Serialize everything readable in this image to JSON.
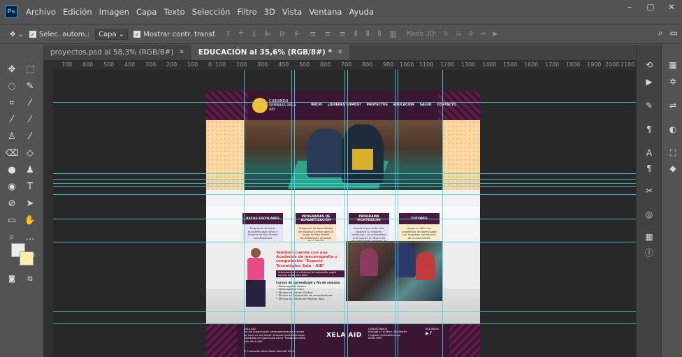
{
  "app": {
    "logo": "Ps"
  },
  "menu": [
    "Archivo",
    "Edición",
    "Imagen",
    "Capa",
    "Texto",
    "Selección",
    "Filtro",
    "3D",
    "Vista",
    "Ventana",
    "Ayuda"
  ],
  "window_controls": {
    "minimize": "–",
    "maximize": "▢",
    "close": "✕"
  },
  "options": {
    "auto_select_label": "Selec. autom.:",
    "auto_select_value": "Capa",
    "show_transform_label": "Mostrar contr. transf.",
    "mode3d_label": "Modo 3D:"
  },
  "tabs": [
    {
      "label": "proyectos.psd al 58,3% (RGB/8#)",
      "close": "✕"
    },
    {
      "label": "EDUCACIÓN al 35,6% (RGB/8#) *",
      "close": "✕"
    }
  ],
  "ruler_ticks": [
    "700",
    "600",
    "500",
    "400",
    "300",
    "200",
    "100",
    "0",
    "100",
    "200",
    "300",
    "400",
    "500",
    "600",
    "700",
    "800",
    "900",
    "1000",
    "1100",
    "1200",
    "1300",
    "1400",
    "1500",
    "1600",
    "1700",
    "1800",
    "1900",
    "2000",
    "2100"
  ],
  "document": {
    "logo_text": "CUIDANDO SEMBRAS XELA AID",
    "nav": [
      "INICIO",
      "¿QUIÉNES SOMOS?",
      "PROYECTOS",
      "EDUCACIÓN",
      "SALUD",
      "CONTACTO"
    ],
    "cards": [
      {
        "title": "BECAS ESCOLARES",
        "body": "Programa de becas escolares para niños y jóvenes de San Martín Sacatepéquez"
      },
      {
        "title": "PROGRAMAS DE ALFABETIZACIÓN",
        "body": "Programa de aprendizaje de español a mam para la mujer de San Martín Sacatepéquez ayudada por CONALFA"
      },
      {
        "title": "PROGRAMA MONTESSORI",
        "body": "Ayuda a que cada niño alcance su máximo potencial. Las actividades promueven el desarrollo de habilidades sociales, el crecimiento emocional y la coordinación física."
      },
      {
        "title": "TUTORES",
        "body": "Apoyo a niños con problemas de aprendizaje por maestros voluntarios de la comunidad."
      }
    ],
    "academy_title": "También cuenta con una Academia de mecanografía y computación \"Espacio Tecnológico Sala - AID\"",
    "academy_bar": "Autorizado por el ministerio de educación, según número de No. 045-2020",
    "academy_list_title": "Cursos de aprendizaje y fin de semana",
    "academy_list": [
      "Mecanografía Básica",
      "Mecanografía Libre",
      "Técnico en Diseño Gráfico",
      "Técnico en Reparación de computadoras",
      "Técnico en Diseño de Páginas Web"
    ],
    "footer": {
      "about_title": "XELA AID",
      "about_text": "Es una organización centroamericana sin ánimo de lucro en San Martín Chiquito Quetzaltenango, registrada en Guatemala como \"Fundación Maria Sala XELA AID\"",
      "brand": "XELA AID",
      "contact_title": "CONTÁCTANOS",
      "contact_address": "Entrada a Txj Mam, San Martín Chiquito, Quetzaltenango",
      "contact_phone": "0008-7999",
      "social_title": "SÍGUENOS",
      "copyright": "© Fundación Maria Stella Sala AID 2021"
    }
  }
}
